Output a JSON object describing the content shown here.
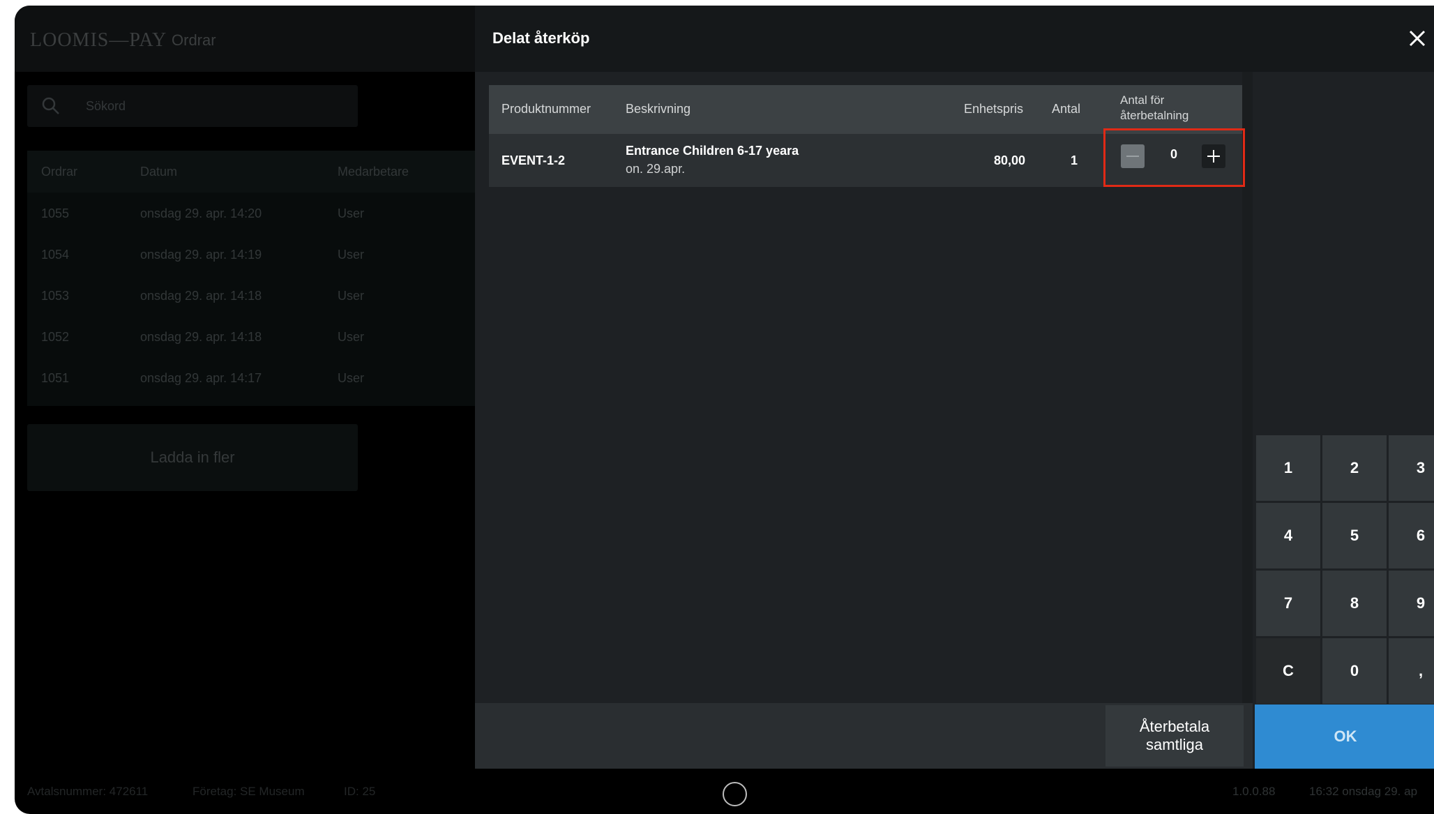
{
  "background_app": {
    "logo": "LOOMIS—PAY",
    "title": "Ordrar",
    "search_placeholder": "Sökord",
    "columns": [
      "Ordrar",
      "Datum",
      "Medarbetare"
    ],
    "orders": [
      {
        "id": "1055",
        "date": "onsdag 29. apr. 14:20",
        "user": "User"
      },
      {
        "id": "1054",
        "date": "onsdag 29. apr. 14:19",
        "user": "User"
      },
      {
        "id": "1053",
        "date": "onsdag 29. apr. 14:18",
        "user": "User"
      },
      {
        "id": "1052",
        "date": "onsdag 29. apr. 14:18",
        "user": "User"
      },
      {
        "id": "1051",
        "date": "onsdag 29. apr. 14:17",
        "user": "User"
      }
    ],
    "load_more": "Ladda in fler",
    "footer": {
      "agreement": "Avtalsnummer: 472611",
      "company": "Företag: SE Museum",
      "id": "ID: 25",
      "version": "1.0.0.88",
      "datetime": "16:32 onsdag 29. ap"
    }
  },
  "modal": {
    "title": "Delat återköp",
    "columns": {
      "product_number": "Produktnummer",
      "description": "Beskrivning",
      "unit_price": "Enhetspris",
      "quantity": "Antal",
      "refund_qty_line1": "Antal för",
      "refund_qty_line2": "återbetalning"
    },
    "row": {
      "product_number": "EVENT-1-2",
      "description": "Entrance Children 6-17 yeara",
      "date": "on. 29.apr.",
      "unit_price": "80,00",
      "quantity": "1",
      "refund_qty": "0"
    },
    "refund_all": "Återbetala samtliga",
    "keypad": [
      "1",
      "2",
      "3",
      "4",
      "5",
      "6",
      "7",
      "8",
      "9",
      "C",
      "0",
      ","
    ],
    "ok": "OK"
  },
  "colors": {
    "highlight": "#e02a16",
    "ok_button": "#2f8bd2"
  }
}
